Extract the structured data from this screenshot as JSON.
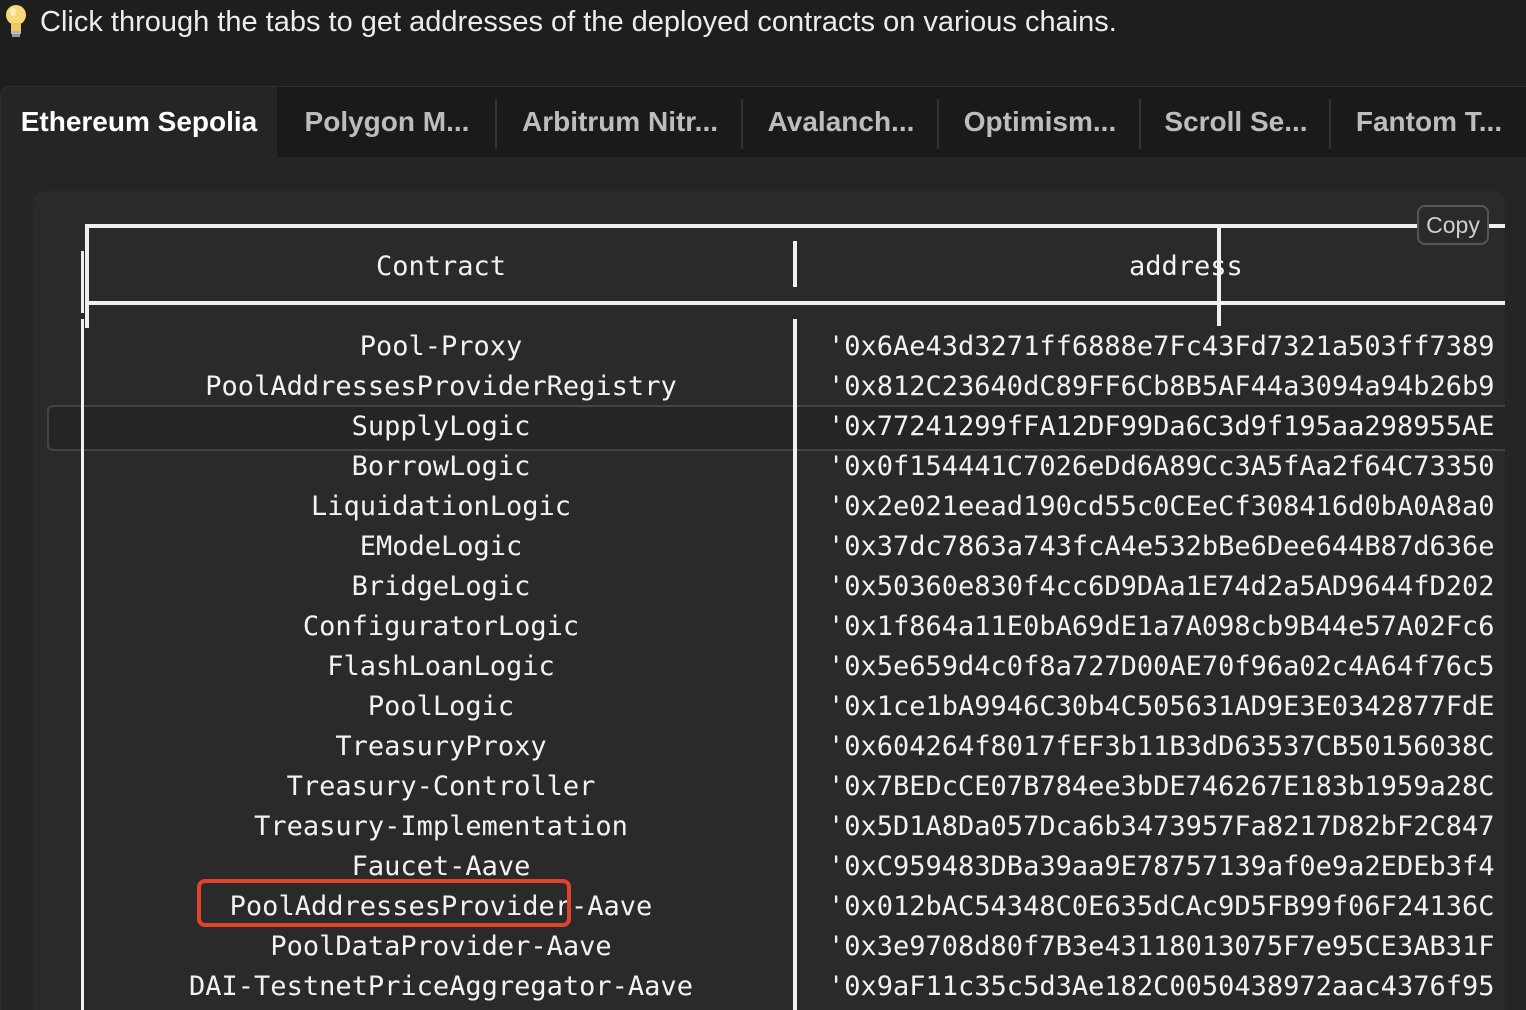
{
  "tip": {
    "icon": "lightbulb-icon",
    "text": "Click through the tabs to get addresses of the deployed contracts on various chains."
  },
  "tabs": [
    {
      "label": "Ethereum Sepolia",
      "active": true
    },
    {
      "label": "Polygon M..."
    },
    {
      "label": "Arbitrum Nitr..."
    },
    {
      "label": "Avalanch..."
    },
    {
      "label": "Optimism..."
    },
    {
      "label": "Scroll Se..."
    },
    {
      "label": "Fantom T..."
    }
  ],
  "copy_label": "Copy",
  "table": {
    "headers": {
      "contract": "Contract",
      "address": "address"
    },
    "rows": [
      {
        "contract": "Pool-Proxy",
        "address": "'0x6Ae43d3271ff6888e7Fc43Fd7321a503ff7389"
      },
      {
        "contract": "PoolAddressesProviderRegistry",
        "address": "'0x812C23640dC89FF6Cb8B5AF44a3094a94b26b9"
      },
      {
        "contract": "SupplyLogic",
        "address": "'0x77241299fFA12DF99Da6C3d9f195aa298955AE"
      },
      {
        "contract": "BorrowLogic",
        "address": "'0x0f154441C7026eDd6A89Cc3A5fAa2f64C73350"
      },
      {
        "contract": "LiquidationLogic",
        "address": "'0x2e021eead190cd55c0CEeCf308416d0bA0A8a0"
      },
      {
        "contract": "EModeLogic",
        "address": "'0x37dc7863a743fcA4e532bBe6Dee644B87d636e"
      },
      {
        "contract": "BridgeLogic",
        "address": "'0x50360e830f4cc6D9DAa1E74d2a5AD9644fD202"
      },
      {
        "contract": "ConfiguratorLogic",
        "address": "'0x1f864a11E0bA69dE1a7A098cb9B44e57A02Fc6"
      },
      {
        "contract": "FlashLoanLogic",
        "address": "'0x5e659d4c0f8a727D00AE70f96a02c4A64f76c5"
      },
      {
        "contract": "PoolLogic",
        "address": "'0x1ce1bA9946C30b4C505631AD9E3E0342877FdE"
      },
      {
        "contract": "TreasuryProxy",
        "address": "'0x604264f8017fEF3b11B3dD63537CB50156038C"
      },
      {
        "contract": "Treasury-Controller",
        "address": "'0x7BEDcCE07B784ee3bDE746267E183b1959a28C"
      },
      {
        "contract": "Treasury-Implementation",
        "address": "'0x5D1A8Da057Dca6b3473957Fa8217D82bF2C847"
      },
      {
        "contract": "Faucet-Aave",
        "address": "'0xC959483DBa39aa9E78757139af0e9a2EDEb3f4"
      },
      {
        "contract": "PoolAddressesProvider-Aave",
        "address": "'0x012bAC54348C0E635dCAc9D5FB99f06F24136C"
      },
      {
        "contract": "PoolDataProvider-Aave",
        "address": "'0x3e9708d80f7B3e43118013075F7e95CE3AB31F"
      },
      {
        "contract": "DAI-TestnetPriceAggregator-Aave",
        "address": "'0x9aF11c35c5d3Ae182C0050438972aac4376f95"
      }
    ]
  }
}
